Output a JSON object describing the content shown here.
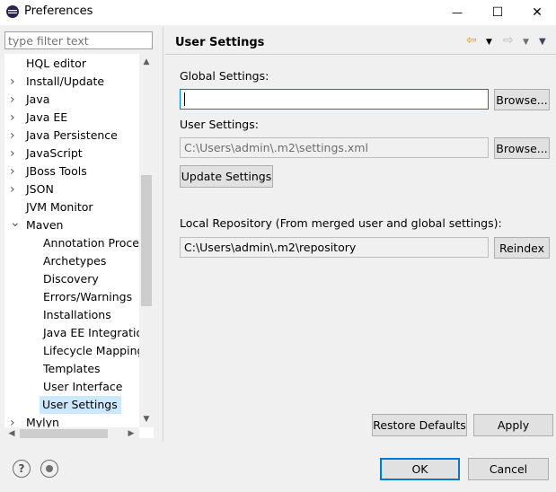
{
  "window": {
    "title": "Preferences",
    "minimize_glyph": "—",
    "maximize_glyph": "☐",
    "close_glyph": "✕"
  },
  "filter": {
    "placeholder": "type filter text"
  },
  "tree": {
    "items": [
      {
        "label": "HQL editor",
        "level": 0,
        "expander": ""
      },
      {
        "label": "Install/Update",
        "level": 0,
        "expander": "›"
      },
      {
        "label": "Java",
        "level": 0,
        "expander": "›"
      },
      {
        "label": "Java EE",
        "level": 0,
        "expander": "›"
      },
      {
        "label": "Java Persistence",
        "level": 0,
        "expander": "›"
      },
      {
        "label": "JavaScript",
        "level": 0,
        "expander": "›"
      },
      {
        "label": "JBoss Tools",
        "level": 0,
        "expander": "›"
      },
      {
        "label": "JSON",
        "level": 0,
        "expander": "›"
      },
      {
        "label": "JVM Monitor",
        "level": 0,
        "expander": ""
      },
      {
        "label": "Maven",
        "level": 0,
        "expander": "⌄"
      },
      {
        "label": "Annotation Proces",
        "level": 1,
        "expander": ""
      },
      {
        "label": "Archetypes",
        "level": 1,
        "expander": ""
      },
      {
        "label": "Discovery",
        "level": 1,
        "expander": ""
      },
      {
        "label": "Errors/Warnings",
        "level": 1,
        "expander": ""
      },
      {
        "label": "Installations",
        "level": 1,
        "expander": ""
      },
      {
        "label": "Java EE Integratio",
        "level": 1,
        "expander": ""
      },
      {
        "label": "Lifecycle Mapping",
        "level": 1,
        "expander": ""
      },
      {
        "label": "Templates",
        "level": 1,
        "expander": ""
      },
      {
        "label": "User Interface",
        "level": 1,
        "expander": ""
      },
      {
        "label": "User Settings",
        "level": 1,
        "expander": "",
        "selected": true
      },
      {
        "label": "Mylyn",
        "level": 0,
        "expander": "›"
      }
    ]
  },
  "page": {
    "title": "User Settings",
    "global_settings_label": "Global Settings:",
    "global_settings_value": "",
    "browse_label": "Browse...",
    "user_settings_label": "User Settings:",
    "user_settings_value": "C:\\Users\\admin\\.m2\\settings.xml",
    "update_settings_label": "Update Settings",
    "local_repo_label": "Local Repository (From merged user and global settings):",
    "local_repo_value": "C:\\Users\\admin\\.m2\\repository",
    "reindex_label": "Reindex",
    "restore_defaults_label": "Restore Defaults",
    "apply_label": "Apply"
  },
  "footer": {
    "help_glyph": "?",
    "ok_label": "OK",
    "cancel_label": "Cancel"
  },
  "colors": {
    "selection": "#cce8ff",
    "focus_border": "#0078d7",
    "nav_back_arrow": "#e0a020"
  }
}
